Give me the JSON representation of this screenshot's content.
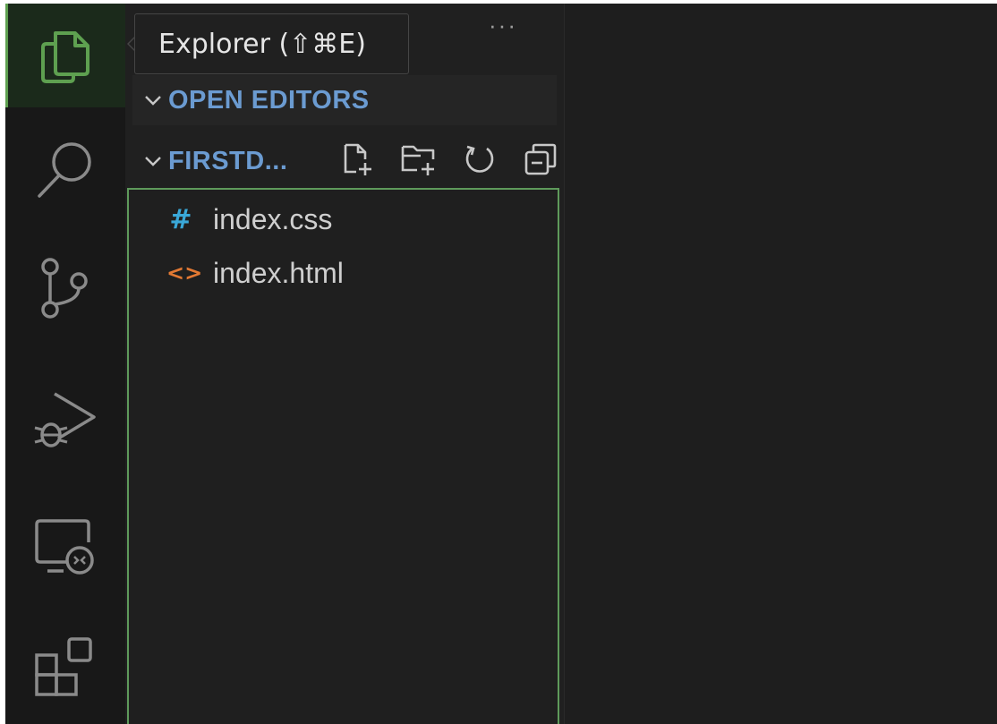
{
  "tooltip": {
    "text": "Explorer (⇧⌘E)"
  },
  "activity_bar": {
    "items": [
      {
        "name": "explorer",
        "icon": "files-icon",
        "active": true
      },
      {
        "name": "search",
        "icon": "search-icon",
        "active": false
      },
      {
        "name": "source-control",
        "icon": "source-control-icon",
        "active": false
      },
      {
        "name": "run-and-debug",
        "icon": "run-debug-icon",
        "active": false
      },
      {
        "name": "remote-explorer",
        "icon": "remote-explorer-icon",
        "active": false
      },
      {
        "name": "extensions",
        "icon": "extensions-icon",
        "active": false
      }
    ]
  },
  "sidebar": {
    "more_actions": "···",
    "open_editors": {
      "title": "OPEN EDITORS",
      "expanded": true
    },
    "folder": {
      "title": "FIRSTD...",
      "expanded": true,
      "actions": [
        "new-file-icon",
        "new-folder-icon",
        "refresh-icon",
        "collapse-all-icon"
      ]
    },
    "files": [
      {
        "icon_glyph": "#",
        "icon": "css-file-icon",
        "name": "index.css"
      },
      {
        "icon_glyph": "<>",
        "icon": "html-file-icon",
        "name": "index.html"
      }
    ]
  },
  "colors": {
    "activity_icon": "#8a8a8a",
    "active_icon": "#5ea050",
    "section_title": "#6b9bd1",
    "css_icon": "#3aa8d8",
    "html_icon": "#e37933",
    "focus_border": "#5e9a5b",
    "file_text": "#cfcfcf"
  }
}
